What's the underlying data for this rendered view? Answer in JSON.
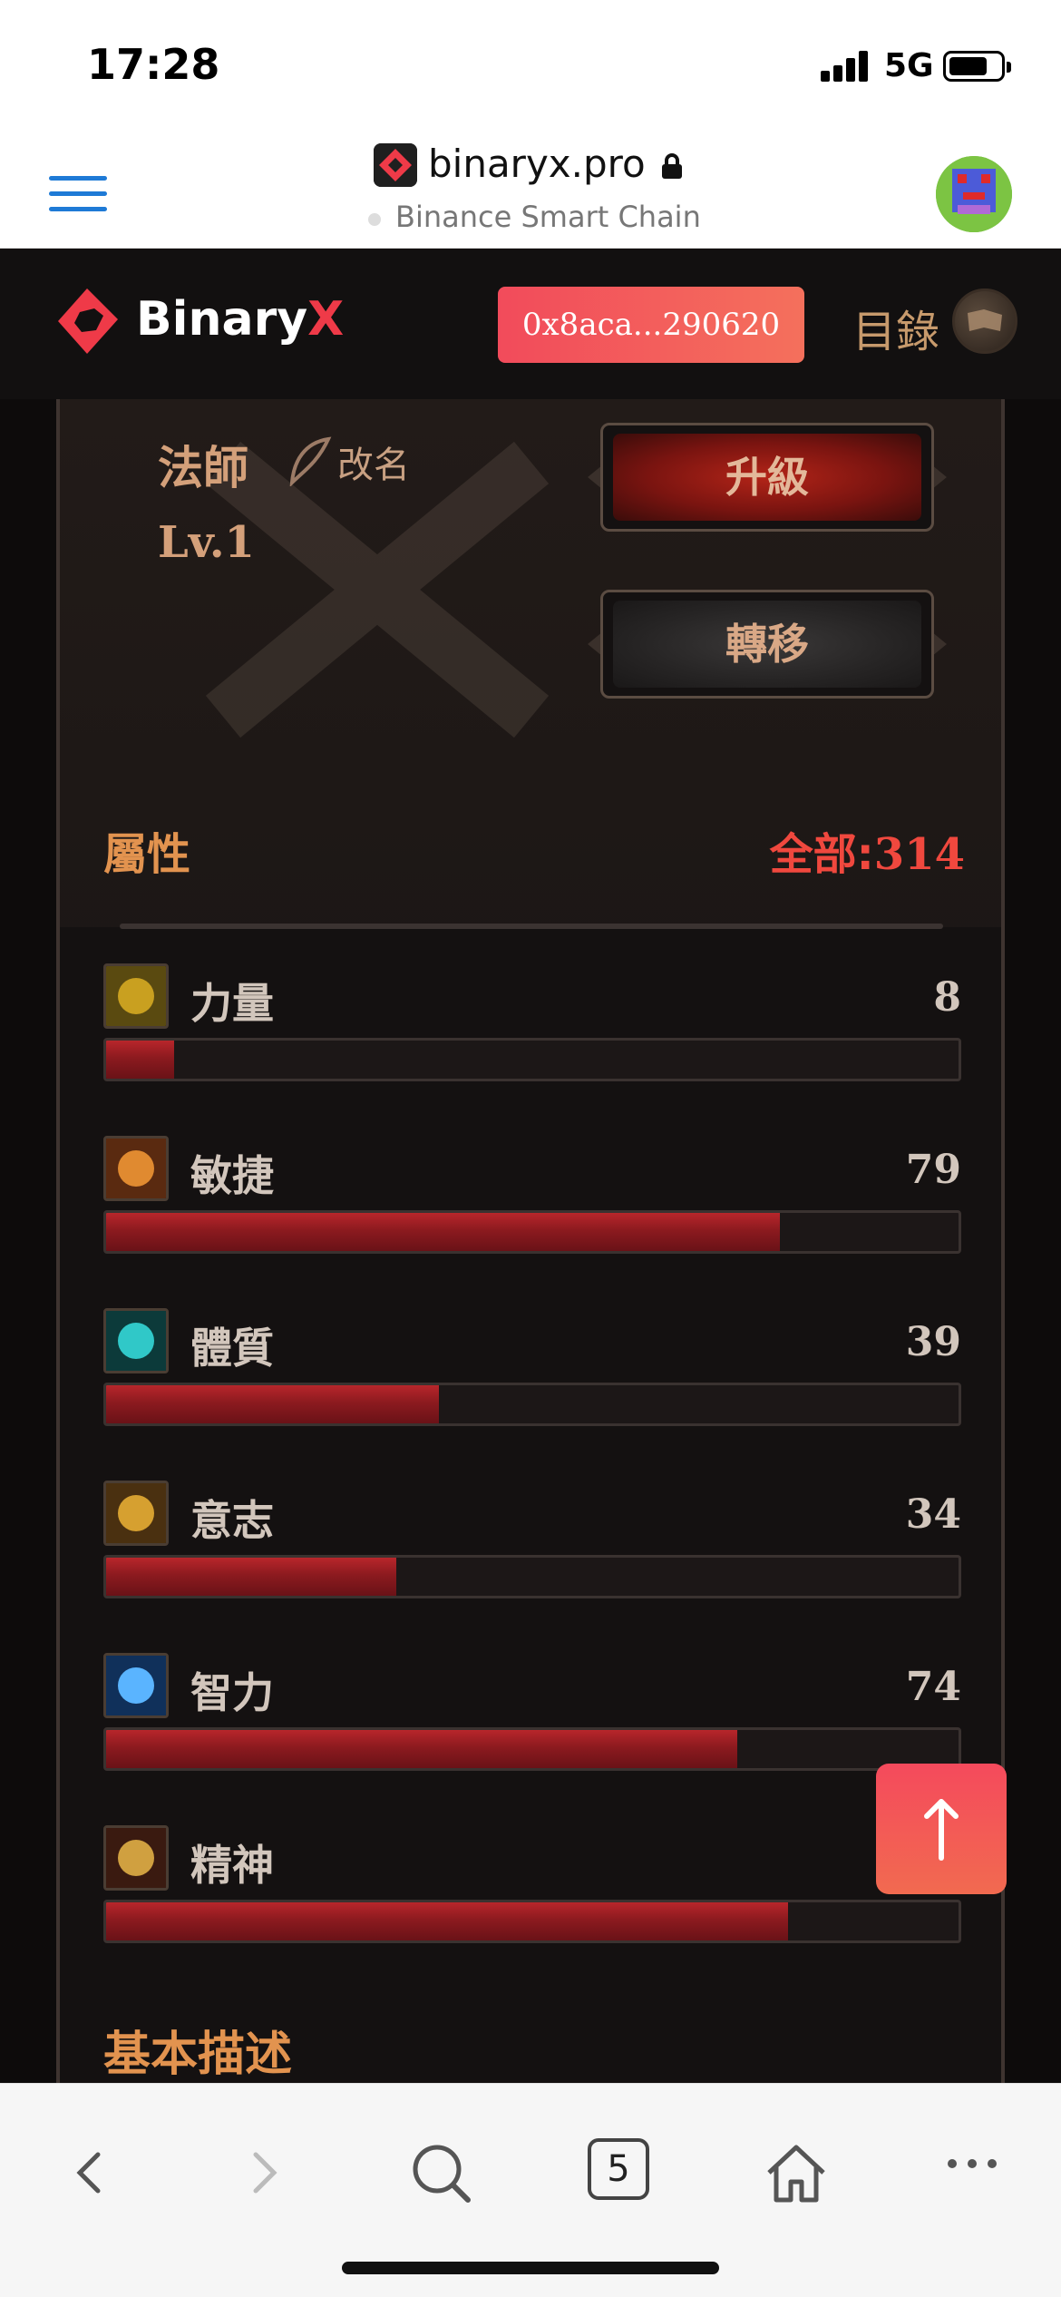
{
  "status_bar": {
    "time": "17:28",
    "network": "5G",
    "battery_level": 0.75
  },
  "browser": {
    "domain": "binaryx.pro",
    "chain": "Binance Smart Chain",
    "open_tabs": "5"
  },
  "header": {
    "logo_text": "Binary",
    "logo_accent": "X",
    "wallet_address": "0x8aca...290620",
    "menu_label": "目錄"
  },
  "hero": {
    "class_name": "法師",
    "rename_label": "改名",
    "level": "Lv.1",
    "upgrade_label": "升級",
    "transfer_label": "轉移"
  },
  "attributes": {
    "title": "屬性",
    "total_label": "全部:",
    "total_value": "314",
    "max_value": 100,
    "items": [
      {
        "label": "力量",
        "value": "8",
        "fill": 0.08,
        "icon": "strength-icon"
      },
      {
        "label": "敏捷",
        "value": "79",
        "fill": 0.79,
        "icon": "agility-icon"
      },
      {
        "label": "體質",
        "value": "39",
        "fill": 0.39,
        "icon": "constitution-icon"
      },
      {
        "label": "意志",
        "value": "34",
        "fill": 0.34,
        "icon": "will-icon"
      },
      {
        "label": "智力",
        "value": "74",
        "fill": 0.74,
        "icon": "intelligence-icon"
      },
      {
        "label": "精神",
        "value": "",
        "fill": 0.8,
        "icon": "spirit-icon"
      }
    ]
  },
  "basic_description": {
    "title": "基本描述"
  },
  "colors": {
    "accent": "#f24b5b",
    "attr_title": "#e2934f",
    "bar_fill": "#9c1d22"
  }
}
